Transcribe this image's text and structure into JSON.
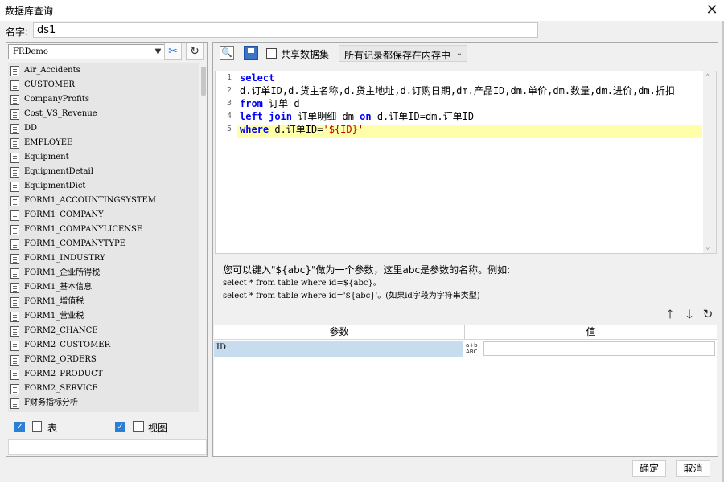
{
  "window": {
    "title": "数据库查询",
    "close_icon": "close-icon"
  },
  "name_row": {
    "label": "名字:",
    "value": "ds1"
  },
  "left_panel": {
    "datasource_selected": "FRDemo",
    "tables": [
      "Air_Accidents",
      "CUSTOMER",
      "CompanyProfits",
      "Cost_VS_Revenue",
      "DD",
      "EMPLOYEE",
      "Equipment",
      "EquipmentDetail",
      "EquipmentDict",
      "FORM1_ACCOUNTINGSYSTEM",
      "FORM1_COMPANY",
      "FORM1_COMPANYLICENSE",
      "FORM1_COMPANYTYPE",
      "FORM1_INDUSTRY",
      "FORM1_企业所得税",
      "FORM1_基本信息",
      "FORM1_增值税",
      "FORM1_营业税",
      "FORM2_CHANCE",
      "FORM2_CUSTOMER",
      "FORM2_ORDERS",
      "FORM2_PRODUCT",
      "FORM2_SERVICE",
      "F财务指标分析"
    ],
    "filter": {
      "table_label": "表",
      "view_label": "视图",
      "table_checked": true,
      "view_checked": true
    }
  },
  "toolbar": {
    "share_label": "共享数据集",
    "share_checked": false,
    "storage_selected": "所有记录都保存在内存中"
  },
  "editor": {
    "lines": [
      {
        "num": "1"
      },
      {
        "num": "2",
        "text": "d.订单ID,d.货主名称,d.货主地址,d.订购日期,dm.产品ID,dm.单价,dm.数量,dm.进价,dm.折扣"
      },
      {
        "num": "3"
      },
      {
        "num": "4"
      },
      {
        "num": "5"
      }
    ],
    "tokens": {
      "select": "select",
      "from": "from",
      "from_rest": " 订单 d",
      "left_join": "left join",
      "join_mid": " 订单明细 dm ",
      "on": "on",
      "on_rest": " d.订单ID=dm.订单ID",
      "where": "where",
      "where_mid": " d.订单ID=",
      "where_str": "'${ID}'"
    }
  },
  "help": {
    "line1": "您可以键入\"${abc}\"做为一个参数，这里abc是参数的名称。例如:",
    "line2": "select * from table where id=${abc}。",
    "line3": "select * from table where id='${abc}'。(如果id字段为字符串类型)"
  },
  "params": {
    "header_name": "参数",
    "header_value": "值",
    "rows": [
      {
        "name": "ID",
        "type_icon": "ABC",
        "type_top": "a+b",
        "value": ""
      }
    ]
  },
  "footer": {
    "ok_label": "确定",
    "cancel_label": "取消"
  }
}
